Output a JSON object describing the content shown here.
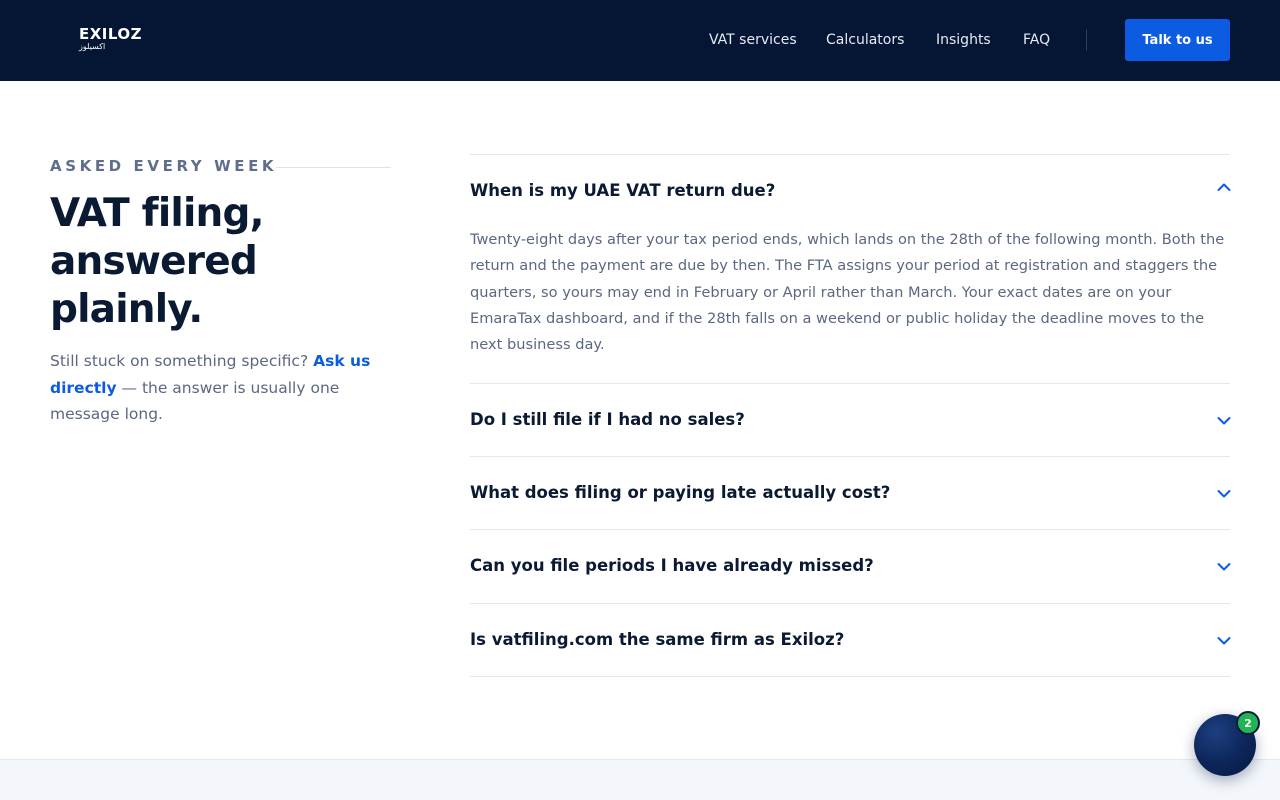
{
  "header": {
    "logo_text": "EXILOZ",
    "logo_arabic": "اكسيلوز",
    "nav": [
      "VAT services",
      "Calculators",
      "Insights",
      "FAQ"
    ],
    "cta_label": "Talk to us",
    "bg_color": "#041634",
    "accent_color": "#0b5ce0"
  },
  "intro": {
    "eyebrow": "ASKED EVERY WEEK",
    "headline_lines": [
      "VAT filing,",
      "answered",
      "plainly."
    ],
    "lede_before": "Still stuck on something specific? ",
    "lede_link": "Ask us directly",
    "lede_after": " — the answer is usually one message long."
  },
  "faq": {
    "items": [
      {
        "question": "When is my UAE VAT return due?",
        "expanded": true,
        "answer": "Twenty-eight days after your tax period ends, which lands on the 28th of the following month. Both the return and the payment are due by then. The FTA assigns your period at registration and staggers the quarters, so yours may end in February or April rather than March. Your exact dates are on your EmaraTax dashboard, and if the 28th falls on a weekend or public holiday the deadline moves to the next business day."
      },
      {
        "question": "Do I still file if I had no sales?",
        "expanded": false
      },
      {
        "question": "What does filing or paying late actually cost?",
        "expanded": false
      },
      {
        "question": "Can you file periods I have already missed?",
        "expanded": false
      },
      {
        "question": "Is vatfiling.com the same firm as Exiloz?",
        "expanded": false
      }
    ]
  },
  "chat": {
    "badge_count": "2",
    "badge_color": "#22b455"
  }
}
